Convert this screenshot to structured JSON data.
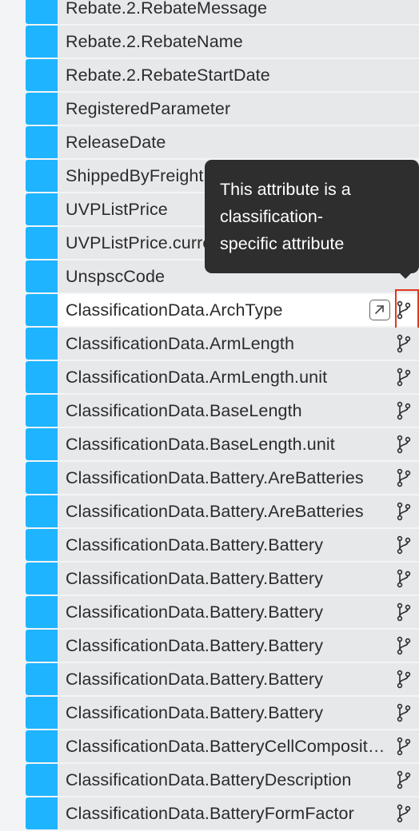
{
  "rows": [
    {
      "label": "Rebate.2.RebateMessage"
    },
    {
      "label": "Rebate.2.RebateName"
    },
    {
      "label": "Rebate.2.RebateStartDate"
    },
    {
      "label": "RegisteredParameter"
    },
    {
      "label": "ReleaseDate"
    },
    {
      "label": "ShippedByFreight"
    },
    {
      "label": "UVPListPrice"
    },
    {
      "label": "UVPListPrice.currency"
    },
    {
      "label": "UnspscCode"
    },
    {
      "label": "ClassificationData.ArchType",
      "classification": true,
      "selected": true
    },
    {
      "label": "ClassificationData.ArmLength",
      "classification": true
    },
    {
      "label": "ClassificationData.ArmLength.unit",
      "classification": true
    },
    {
      "label": "ClassificationData.BaseLength",
      "classification": true
    },
    {
      "label": "ClassificationData.BaseLength.unit",
      "classification": true
    },
    {
      "label": "ClassificationData.Battery.AreBatteries",
      "classification": true
    },
    {
      "label": "ClassificationData.Battery.AreBatteries",
      "classification": true
    },
    {
      "label": "ClassificationData.Battery.Battery",
      "classification": true
    },
    {
      "label": "ClassificationData.Battery.Battery",
      "classification": true
    },
    {
      "label": "ClassificationData.Battery.Battery",
      "classification": true
    },
    {
      "label": "ClassificationData.Battery.Battery",
      "classification": true
    },
    {
      "label": "ClassificationData.Battery.Battery",
      "classification": true
    },
    {
      "label": "ClassificationData.Battery.Battery",
      "classification": true
    },
    {
      "label": "ClassificationData.BatteryCellComposition",
      "classification": true
    },
    {
      "label": "ClassificationData.BatteryDescription",
      "classification": true
    },
    {
      "label": "ClassificationData.BatteryFormFactor",
      "classification": true
    }
  ],
  "tooltip": {
    "line1": "This attribute is a",
    "line2": "classification-",
    "line3": "specific attribute"
  },
  "icons": {
    "classification": "git-branch-icon",
    "open": "open-external-icon"
  },
  "colors": {
    "swatch": "#1eb4ff",
    "highlight": "#e2361f",
    "tooltip_bg": "#2e2e2e"
  }
}
